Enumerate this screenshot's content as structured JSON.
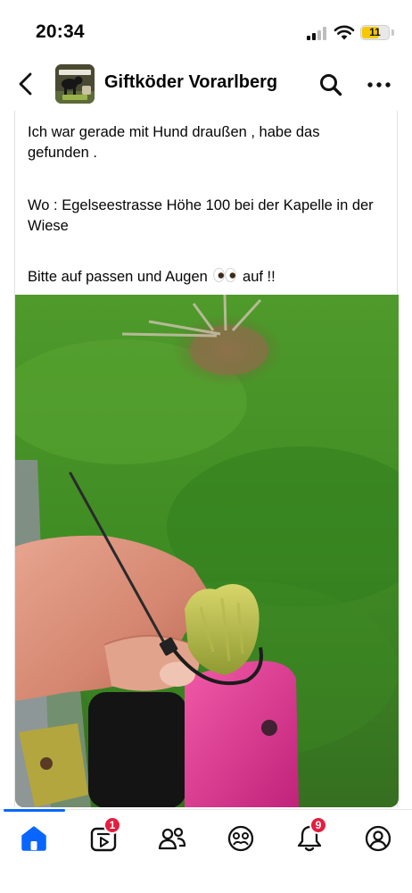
{
  "status_bar": {
    "time": "20:34",
    "battery_level": "11"
  },
  "header": {
    "group_name": "Giftköder Vorarlberg",
    "icons": [
      "chevron-left-icon",
      "group-avatar",
      "search-icon",
      "more-icon"
    ]
  },
  "post": {
    "paragraphs": [
      "Ich war gerade mit Hund draußen , habe das gefunden .",
      "Wo : Egelseestrasse Höhe 100 bei der Kapelle in der Wiese"
    ],
    "warning_before": "Bitte auf passen und Augen",
    "warning_after": "auf !!",
    "image_alt": "Hand holding a green bait with a cable tie over grass"
  },
  "tab_bar": {
    "active_tab": "home",
    "video_badge": "1",
    "notifications_badge": "9",
    "accent_color": "#0866ff",
    "badge_color": "#e41e3f"
  }
}
